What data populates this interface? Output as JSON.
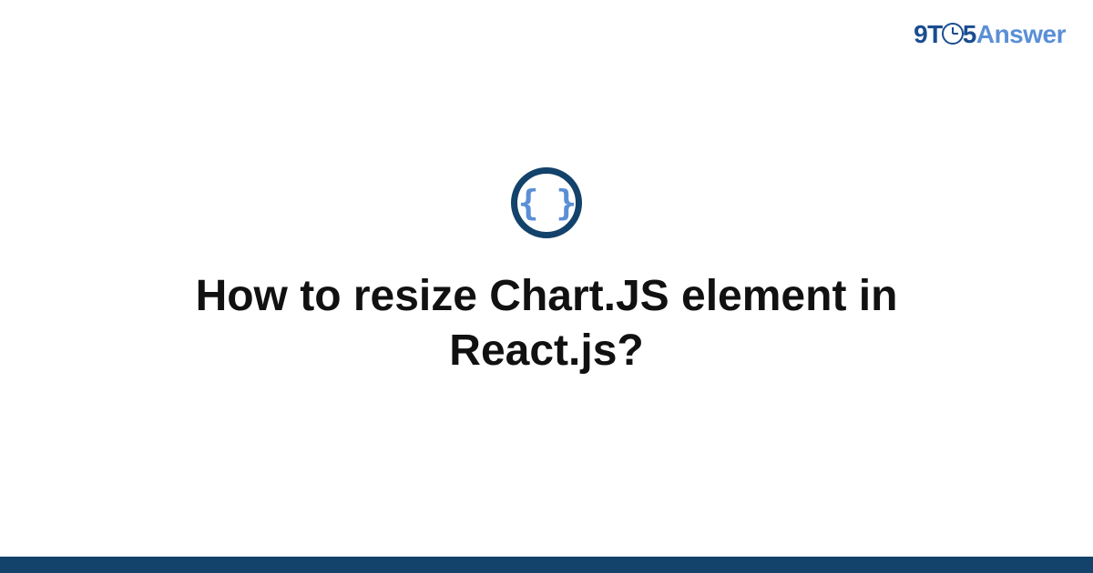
{
  "brand": {
    "part1": "9T",
    "part2": "5",
    "part3": "Answer"
  },
  "category_glyph": "{ }",
  "question_title": "How to resize Chart.JS element in React.js?",
  "colors": {
    "brand_dark": "#1a4d8f",
    "brand_light": "#5a8fd6",
    "icon_ring": "#13426b",
    "bottom_bar": "#13426b",
    "title_text": "#111111"
  }
}
